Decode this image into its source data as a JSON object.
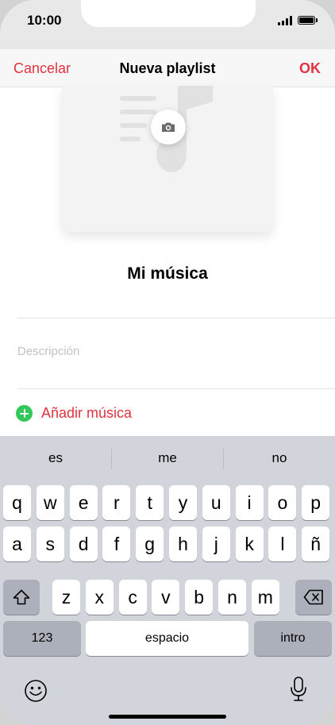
{
  "status_bar": {
    "time": "10:00"
  },
  "nav": {
    "cancel": "Cancelar",
    "title": "Nueva playlist",
    "ok": "OK"
  },
  "playlist": {
    "name": "Mi música",
    "description_placeholder": "Descripción",
    "add_music": "Añadir música"
  },
  "keyboard": {
    "suggestions": [
      "es",
      "me",
      "no"
    ],
    "row1": [
      "q",
      "w",
      "e",
      "r",
      "t",
      "y",
      "u",
      "i",
      "o",
      "p"
    ],
    "row2": [
      "a",
      "s",
      "d",
      "f",
      "g",
      "h",
      "j",
      "k",
      "l",
      "ñ"
    ],
    "row3": [
      "z",
      "x",
      "c",
      "v",
      "b",
      "n",
      "m"
    ],
    "numbers_key": "123",
    "space_key": "espacio",
    "return_key": "intro"
  },
  "colors": {
    "accent": "#e0333f",
    "add_icon": "#33c759",
    "keyboard_bg": "#d1d4da",
    "special_key": "#abb0ba"
  },
  "icons": {
    "artwork_placeholder": "music-note-icon",
    "camera": "camera-icon",
    "add": "plus-circle-icon",
    "shift": "shift-icon",
    "delete": "delete-icon",
    "emoji": "emoji-icon",
    "dictation": "microphone-icon"
  }
}
